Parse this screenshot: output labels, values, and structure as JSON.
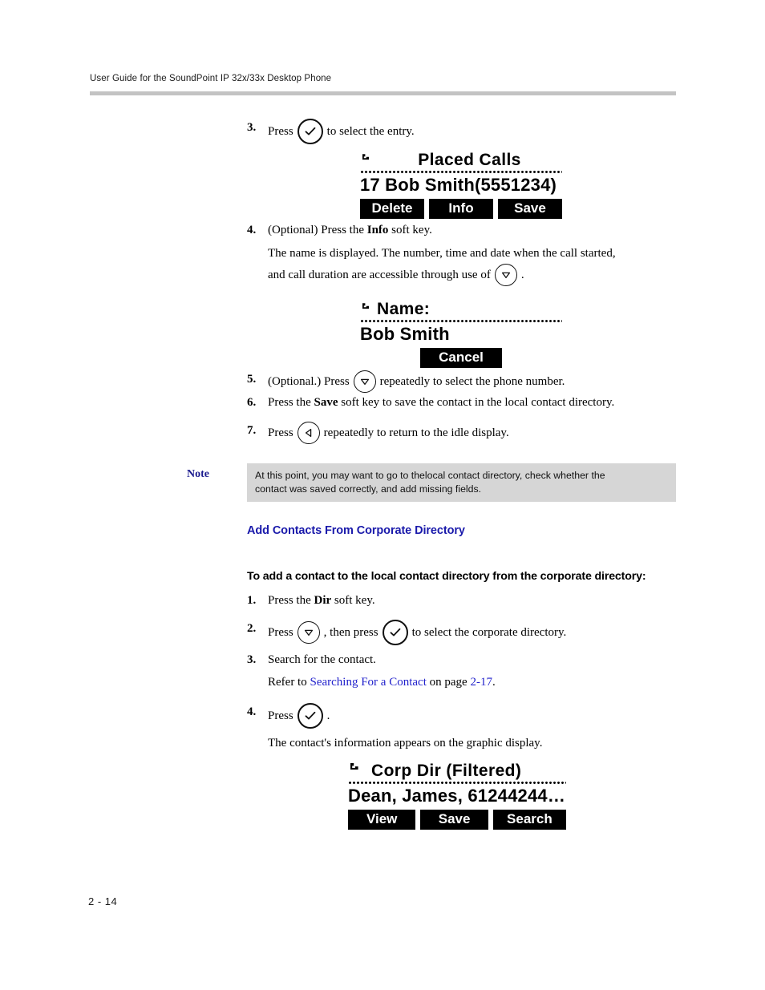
{
  "header": {
    "running_head": "User Guide for the SoundPoint IP 32x/33x Desktop Phone"
  },
  "footer": {
    "page_number": "2 - 14"
  },
  "steps_top": [
    {
      "num": "3.",
      "pre": "Press",
      "icon": "select-check-key-icon",
      "post": "to select the entry."
    },
    {
      "num": "4.",
      "pre": "(Optional) Press the",
      "bold": "Info",
      "post": "soft key."
    }
  ],
  "step4_description": {
    "line1": "The name is displayed. The number, time and date when the call started,",
    "line2_pre": "and call duration are accessible through use of",
    "line2_icon": "down-arrow-key-icon",
    "line2_post": "."
  },
  "steps_mid": [
    {
      "num": "5.",
      "pre": "(Optional.) Press",
      "icon": "down-arrow-key-icon",
      "post": "repeatedly to select the phone number."
    },
    {
      "num": "6.",
      "pre": "Press the",
      "bold": "Save",
      "post": "soft key to save the contact in the local contact directory."
    },
    {
      "num": "7.",
      "pre": "Press",
      "icon": "left-arrow-key-icon",
      "post": "repeatedly to return to the idle display."
    }
  ],
  "note": {
    "label": "Note",
    "line1": "At this point, you may want to go to thelocal contact directory, check whether the",
    "line2": "contact was saved correctly, and add missing fields.",
    "label_color": "#1c1c8f",
    "box_color": "#d6d6d6"
  },
  "section": {
    "heading": "Add Contacts From Corporate Directory",
    "heading_color": "#1a1aab",
    "intro": "To add a contact to the local contact directory from the corporate directory:"
  },
  "steps_bottom": [
    {
      "num": "1.",
      "pre": "Press the",
      "bold": "Dir",
      "post": "soft key."
    },
    {
      "num": "2.",
      "pre": "Press",
      "icon1": "down-arrow-key-icon",
      "mid": ", then press",
      "icon2": "select-check-key-icon",
      "post": "to select the corporate directory."
    },
    {
      "num": "3.",
      "pre": "Search for the contact."
    },
    {
      "num": "4.",
      "pre": "Press",
      "icon": "select-check-key-icon",
      "post": "."
    }
  ],
  "step3_refer": {
    "pre": "Refer to",
    "link": "Searching For a Contact",
    "mid": "on page",
    "page_link": "2-17",
    "post": ".",
    "link_color": "#2222cc"
  },
  "step4_result": "The contact's information appears on the graphic display.",
  "lcd_screens": [
    {
      "id": "placed-calls",
      "icon": "handset-icon",
      "title": "Placed Calls",
      "title_centered": true,
      "entry": "17 Bob Smith(5551234)",
      "softkeys": [
        "Delete",
        "Info",
        "Save"
      ],
      "softkeys_centered": false
    },
    {
      "id": "name-detail",
      "icon": "handset-icon",
      "title": "Name:",
      "title_centered": false,
      "entry": "Bob Smith",
      "softkeys": [
        "Cancel"
      ],
      "softkeys_centered": true
    },
    {
      "id": "corp-dir-filtered",
      "icon": "handset-icon",
      "title": "Corp Dir (Filtered)",
      "title_centered": false,
      "entry": "Dean, James, 61244244…",
      "softkeys": [
        "View",
        "Save",
        "Search"
      ],
      "softkeys_centered": false
    }
  ]
}
